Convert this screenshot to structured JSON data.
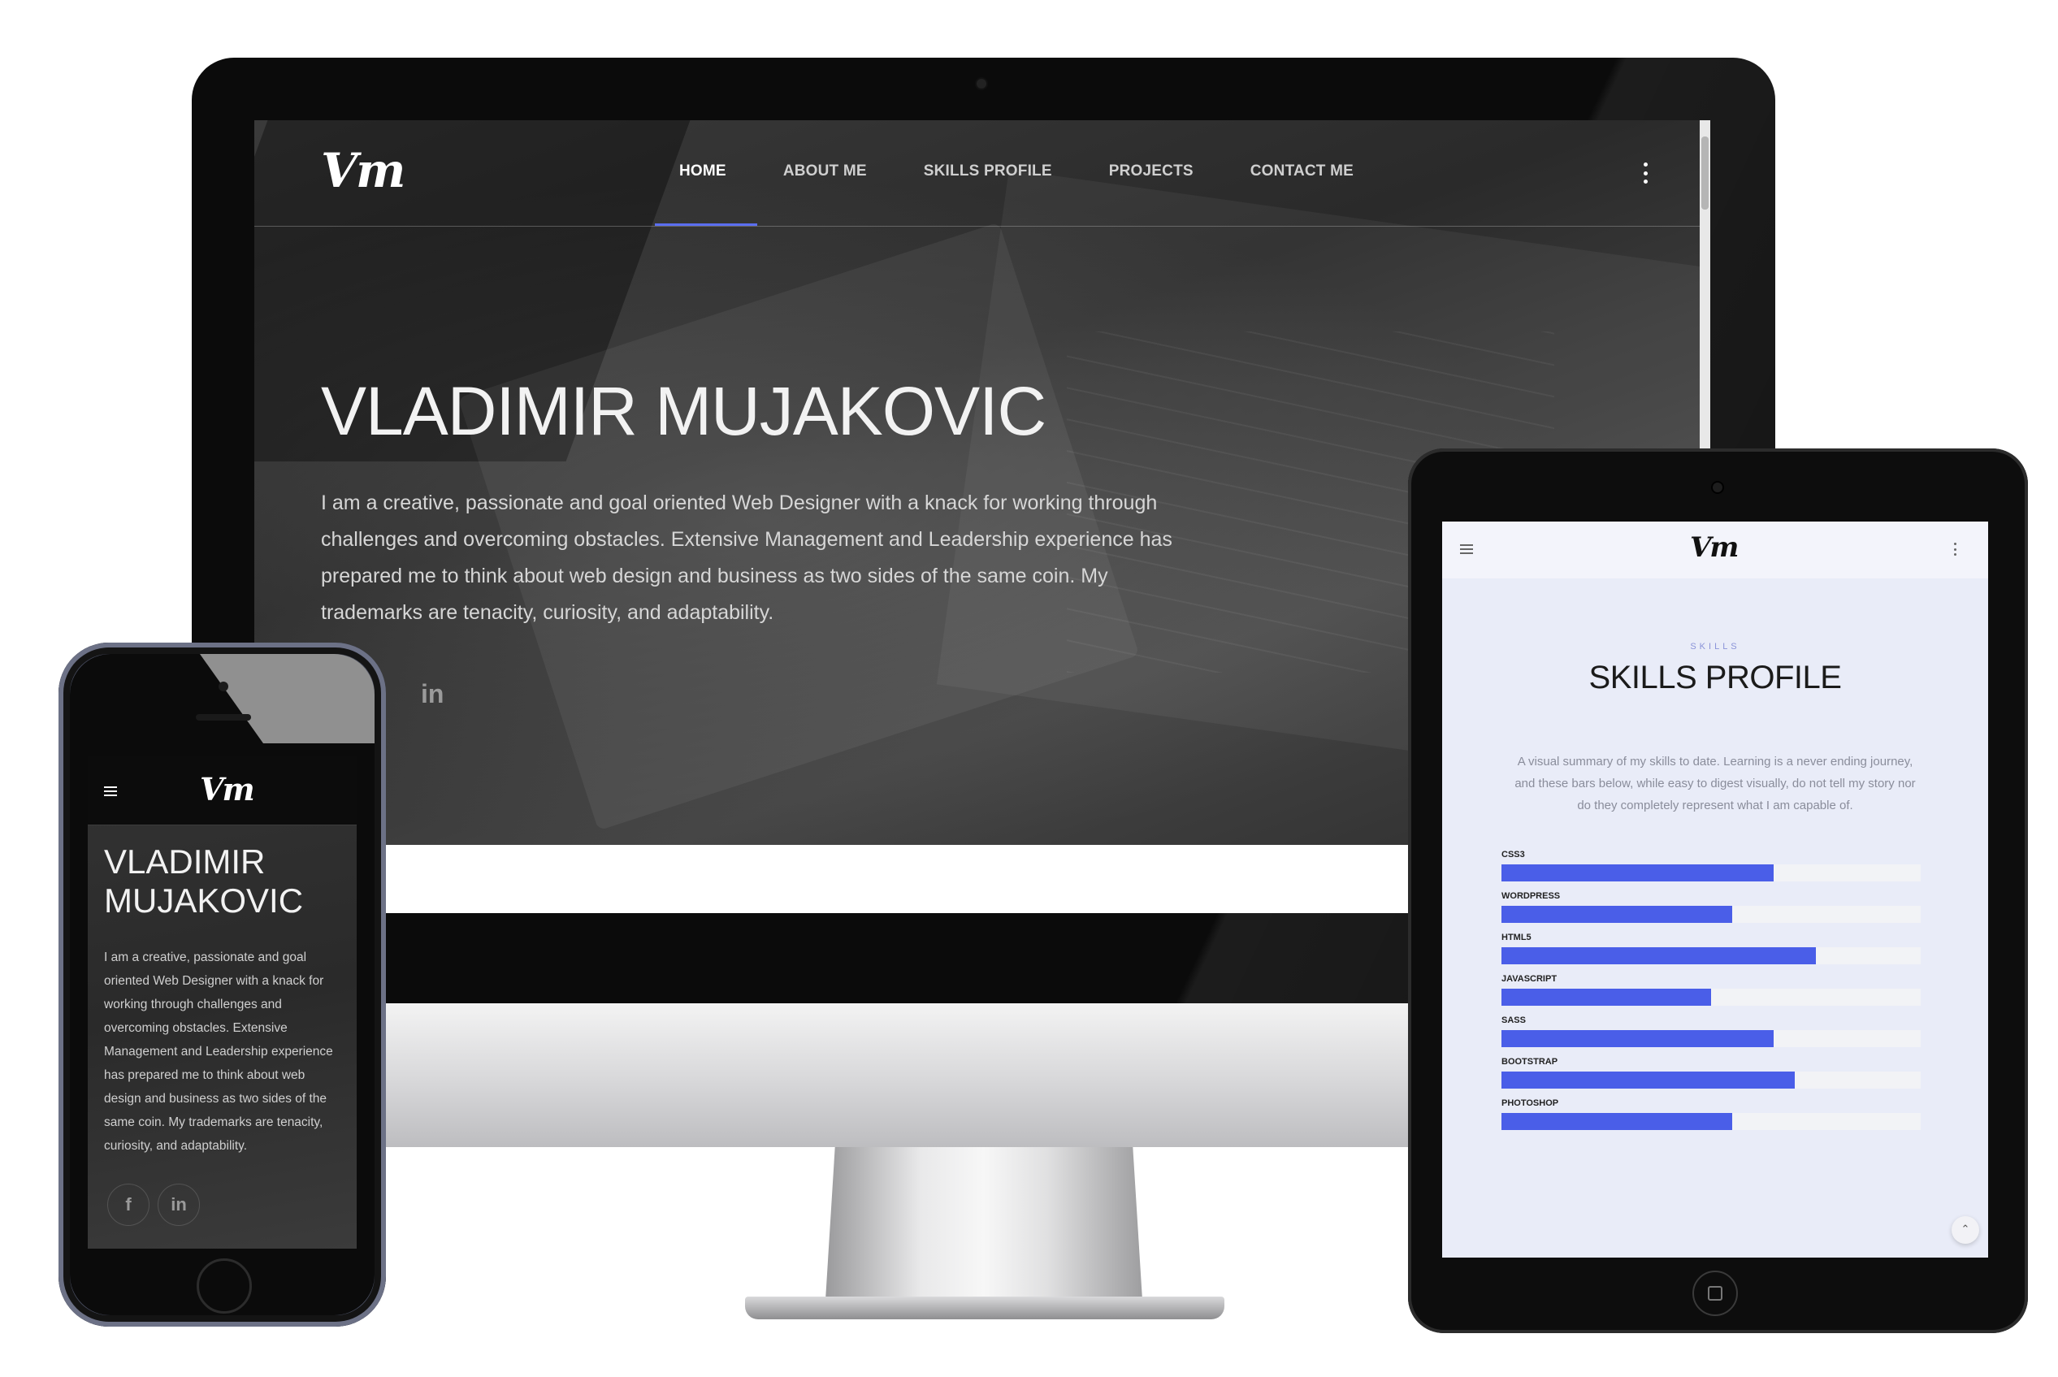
{
  "desktop": {
    "logo": "Vm",
    "nav": [
      {
        "label": "HOME",
        "active": true
      },
      {
        "label": "ABOUT ME",
        "active": false
      },
      {
        "label": "SKILLS PROFILE",
        "active": false
      },
      {
        "label": "PROJECTS",
        "active": false
      },
      {
        "label": "CONTACT ME",
        "active": false
      }
    ],
    "hero_title": "VLADIMIR MUJAKOVIC",
    "hero_text": "I am a creative, passionate and goal oriented Web Designer with a knack for working through challenges and overcoming obstacles. Extensive Management and Leadership experience has prepared me to think about web design and business as two sides of the same coin. My trademarks are tenacity, curiosity, and adaptability.",
    "social": [
      "in"
    ],
    "accent_color": "#5a6ef0"
  },
  "tablet": {
    "logo": "Vm",
    "eyebrow": "SKILLS",
    "title": "SKILLS PROFILE",
    "description": "A visual summary of my skills to date. Learning is a never ending journey, and these bars below, while easy to digest visually, do not tell my story nor do they completely represent what I am capable of.",
    "skills": [
      {
        "label": "CSS3",
        "level": 0.65
      },
      {
        "label": "WORDPRESS",
        "level": 0.55
      },
      {
        "label": "HTML5",
        "level": 0.75
      },
      {
        "label": "JAVASCRIPT",
        "level": 0.5
      },
      {
        "label": "SASS",
        "level": 0.65
      },
      {
        "label": "BOOTSTRAP",
        "level": 0.7
      },
      {
        "label": "PHOTOSHOP",
        "level": 0.55
      }
    ],
    "bar_color": "#4a5ee8",
    "scroll_up_icon": "chevron-up-icon"
  },
  "phone": {
    "logo": "Vm",
    "hero_title": "VLADIMIR MUJAKOVIC",
    "hero_text": "I am a creative, passionate and goal oriented Web Designer with a knack for working through challenges and overcoming obstacles. Extensive Management and Leadership experience has prepared me to think about web design and business as two sides of the same coin. My trademarks are tenacity, curiosity, and adaptability.",
    "social": [
      "f",
      "in"
    ]
  }
}
